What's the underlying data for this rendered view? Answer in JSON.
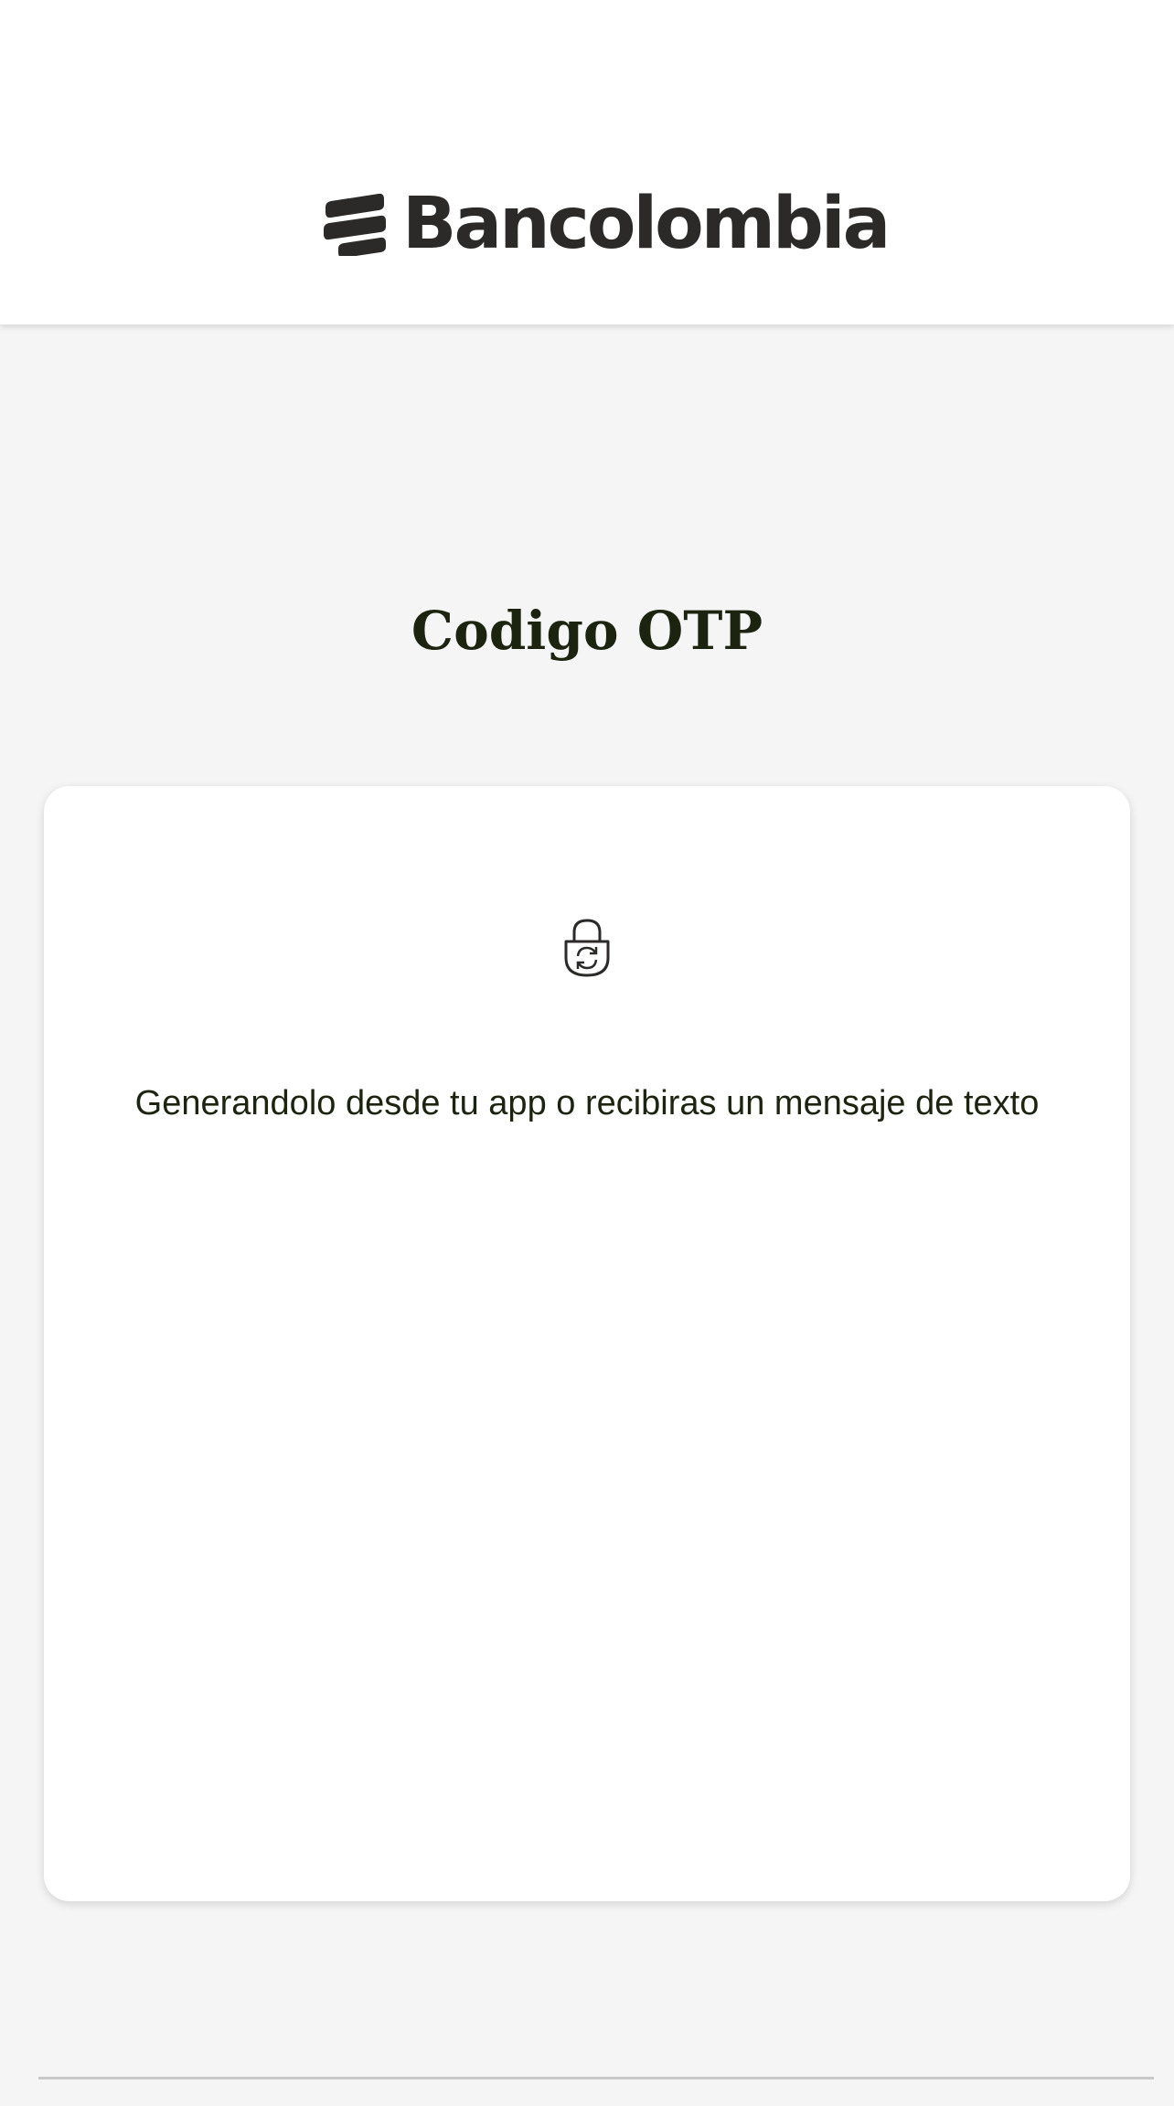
{
  "header": {
    "brand_name": "Bancolombia",
    "logo_icon": "bancolombia-stripes-logo"
  },
  "main": {
    "title": "Codigo OTP",
    "card": {
      "icon": "lock-refresh-icon",
      "message": "Generandolo desde tu app o recibiras un mensaje de texto"
    }
  },
  "colors": {
    "background": "#f5f5f5",
    "header_background": "#ffffff",
    "brand_text": "#2c2a29",
    "title_text": "#1c2410",
    "card_background": "#ffffff"
  }
}
